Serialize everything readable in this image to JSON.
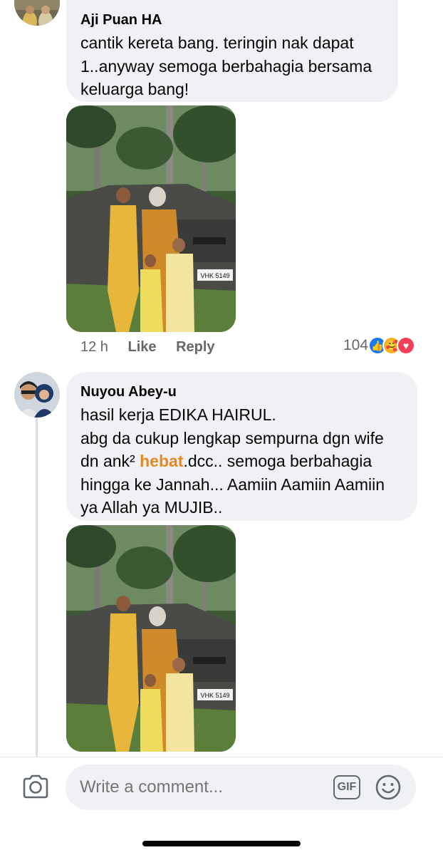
{
  "comments": [
    {
      "author": "Aji Puan HA",
      "text": "cantik kereta bang. teringin nak dapat 1..anyway semoga berbahagia bersama keluarga bang!",
      "time": "12 h",
      "like_label": "Like",
      "reply_label": "Reply",
      "reaction_count": "104",
      "reactions": [
        "like-icon",
        "care-icon",
        "love-icon"
      ],
      "plate": "VHK 5149"
    },
    {
      "author": "Nuyou Abey-u",
      "lines": [
        "hasil kerja EDIKA HAIRUL.",
        "abg da cukup lengkap sempurna dgn wife",
        "dn ank²",
        "hebat",
        ".dcc.. semoga berbahagia",
        "hingga ke Jannah... Aamiin Aamiin Aamiin",
        "ya Allah ya MUJIB.."
      ],
      "plate": "VHK 5149"
    }
  ],
  "composer": {
    "placeholder": "Write a comment...",
    "gif_label": "GIF"
  },
  "colors": {
    "bubble": "#eff1f4",
    "highlight": "#e28a26",
    "like": "#1877f2",
    "love": "#f33e58",
    "care": "#f7b125"
  }
}
